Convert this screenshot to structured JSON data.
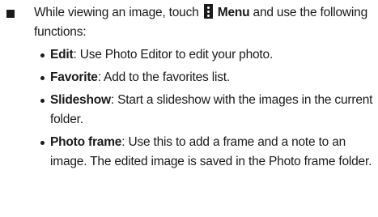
{
  "intro": {
    "prefix": "While viewing an image, touch",
    "menu_label": "Menu",
    "suffix": " and use the following functions:"
  },
  "functions": [
    {
      "name": "Edit",
      "description": ": Use Photo Editor to edit your photo."
    },
    {
      "name": "Favorite",
      "description": ": Add to the favorites list."
    },
    {
      "name": "Slideshow",
      "description": ": Start a slideshow with the images in the current folder."
    },
    {
      "name": "Photo frame",
      "description": ": Use this to add a frame and a note to an image. The edited image is saved in the Photo frame folder."
    }
  ]
}
